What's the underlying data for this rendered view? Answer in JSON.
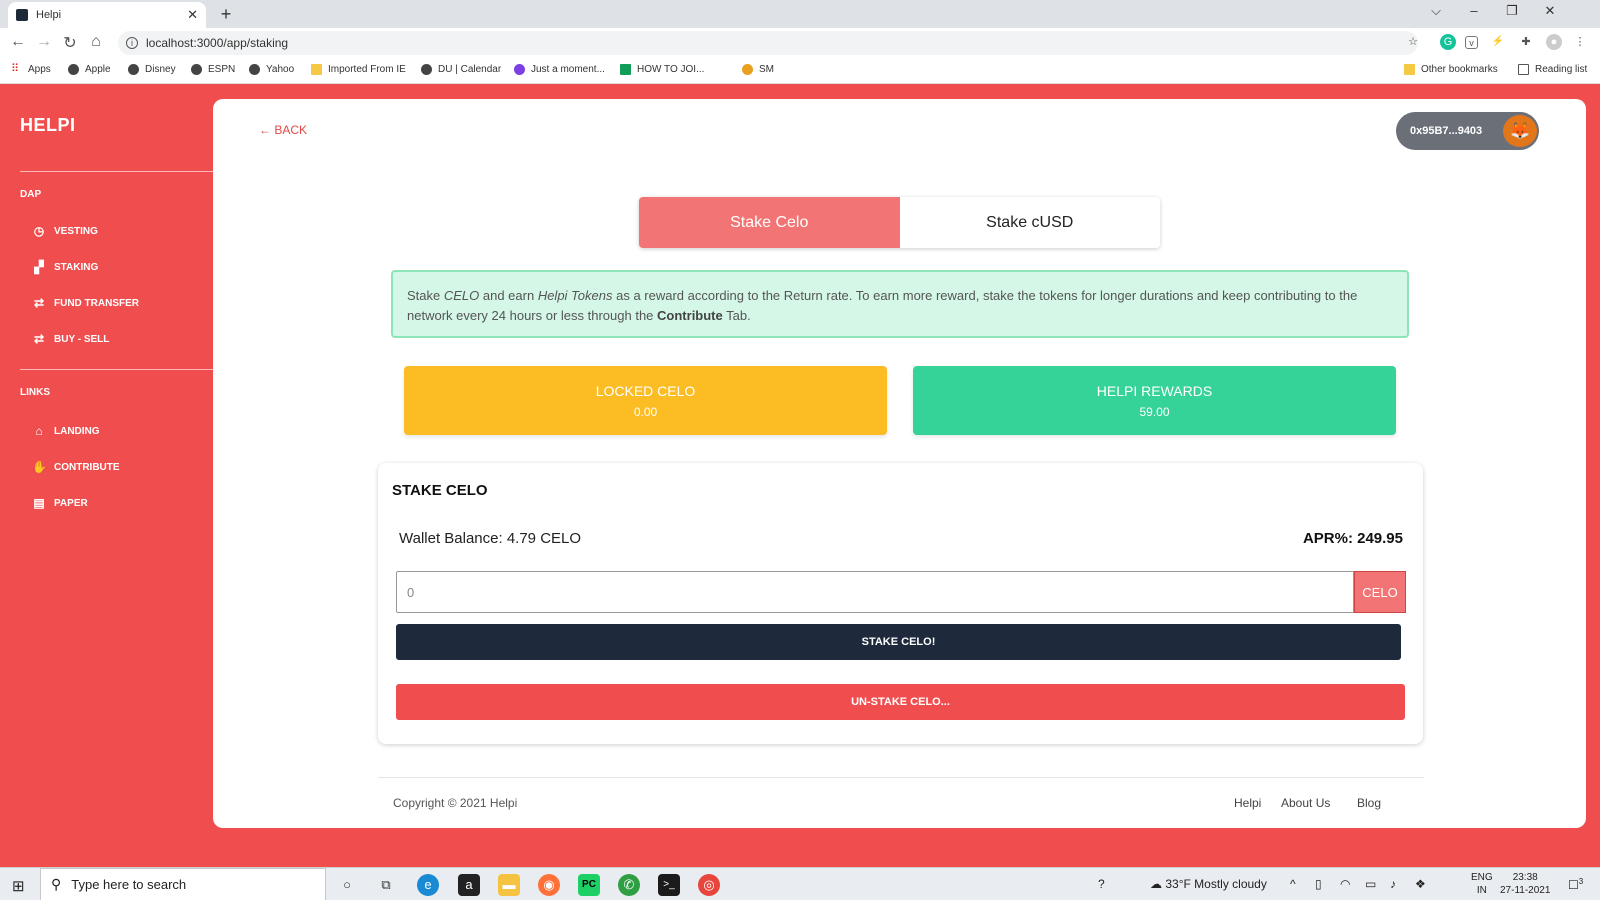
{
  "browser": {
    "tab_title": "Helpi",
    "tab_close": "✕",
    "new_tab": "+",
    "url": "localhost:3000/app/staking",
    "window_controls": {
      "dropdown": "⌵",
      "minimize": "–",
      "restore": "❐",
      "close": "✕"
    },
    "bookmarks": [
      "Apps",
      "Apple",
      "Disney",
      "ESPN",
      "Yahoo",
      "Imported From IE",
      "DU | Calendar",
      "Just a moment...",
      "HOW TO JOI...",
      "SM"
    ],
    "other_bookmarks": "Other bookmarks",
    "reading_list": "Reading list"
  },
  "sidebar": {
    "brand": "HELPI",
    "sections": [
      {
        "title": "DAP",
        "items": [
          {
            "label": "VESTING",
            "icon": "clock-icon"
          },
          {
            "label": "STAKING",
            "icon": "stack-icon"
          },
          {
            "label": "FUND TRANSFER",
            "icon": "exchange-icon"
          },
          {
            "label": "BUY - SELL",
            "icon": "exchange-icon"
          }
        ]
      },
      {
        "title": "LINKS",
        "items": [
          {
            "label": "LANDING",
            "icon": "home-icon"
          },
          {
            "label": "CONTRIBUTE",
            "icon": "handshake-icon"
          },
          {
            "label": "PAPER",
            "icon": "document-icon"
          }
        ]
      }
    ]
  },
  "header": {
    "back_label": "BACK",
    "wallet_address": "0x95B7...9403"
  },
  "stake_tabs": [
    {
      "label": "Stake Celo",
      "active": true
    },
    {
      "label": "Stake cUSD",
      "active": false
    }
  ],
  "info": {
    "p1": "Stake ",
    "em1": "CELO",
    "p2": " and earn ",
    "em2": "Helpi Tokens",
    "p3": " as a reward according to the Return rate. To earn more reward, stake the tokens for longer durations and keep contributing to the network every 24 hours or less through the ",
    "bold": "Contribute",
    "p4": " Tab."
  },
  "stats": {
    "locked_label": "LOCKED CELO",
    "locked_value": "0.00",
    "rewards_label": "HELPI REWARDS",
    "rewards_value": "59.00"
  },
  "stake_panel": {
    "title": "STAKE CELO",
    "wallet_balance": "Wallet Balance: 4.79 CELO",
    "apr": "APR%: 249.95",
    "amount_placeholder": "0",
    "unit": "CELO",
    "stake_button": "STAKE CELO!",
    "unstake_button": "UN-STAKE CELO..."
  },
  "footer": {
    "copyright": "Copyright © 2021 Helpi",
    "links": [
      "Helpi",
      "About Us",
      "Blog"
    ]
  },
  "taskbar": {
    "search_placeholder": "Type here to search",
    "weather": "33°F  Mostly cloudy",
    "lang_1": "ENG",
    "lang_2": "IN",
    "time": "23:38",
    "date": "27-11-2021",
    "notification_count": "3"
  },
  "colors": {
    "brand_red": "#f04e4e",
    "tab_active": "#f37474",
    "locked_yellow": "#fbbd23",
    "rewards_green": "#36d399",
    "stake_button": "#1e2a3c",
    "alert_bg": "#d4f7e7"
  }
}
